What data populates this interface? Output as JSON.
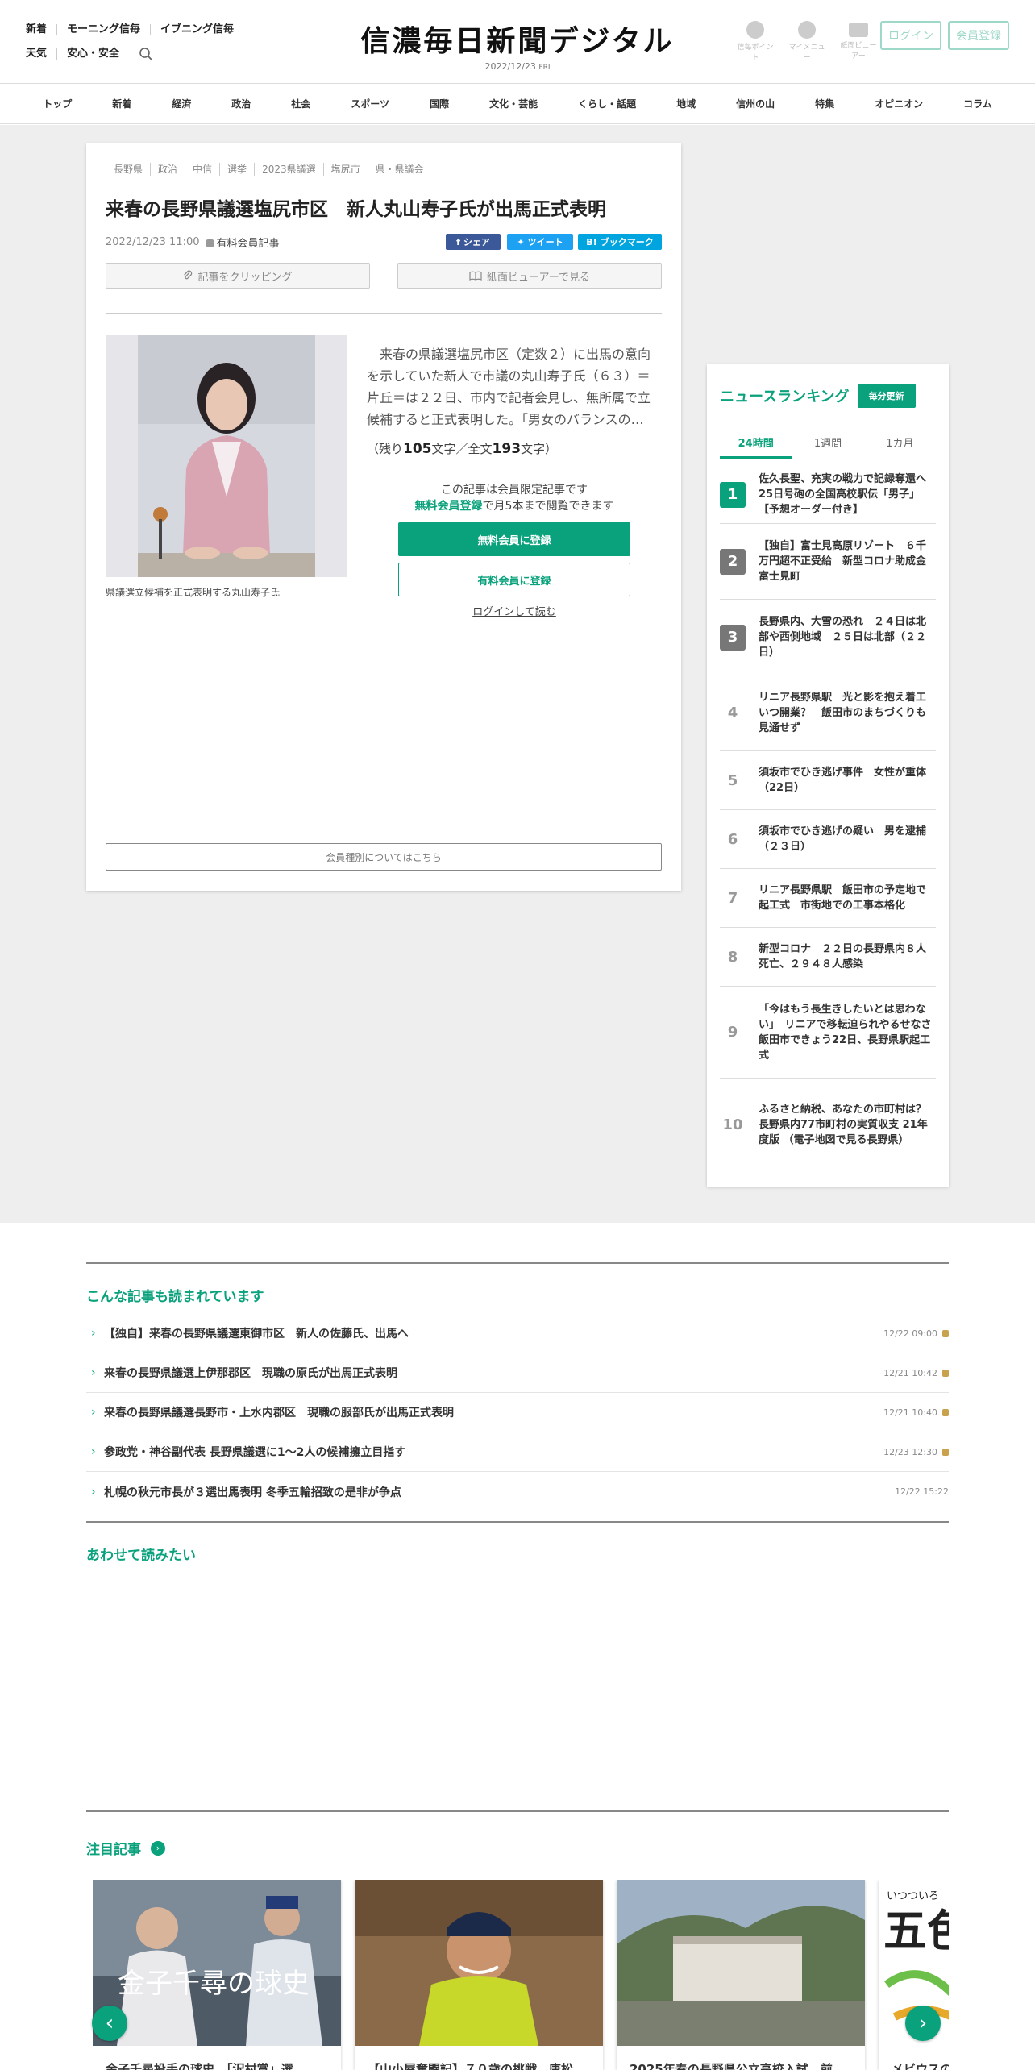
{
  "header": {
    "links_row1": [
      "新着",
      "モーニング信毎",
      "イブニング信毎"
    ],
    "links_row2": [
      "天気",
      "安心・安全"
    ],
    "logo": "信濃毎日新聞デジタル",
    "date": "2022/12/23",
    "weekday": "FRI",
    "icons": [
      {
        "label": "信毎ポイント",
        "icon": "point-icon"
      },
      {
        "label": "マイメニュー",
        "icon": "user-icon"
      },
      {
        "label": "紙面ビューアー",
        "icon": "book-icon"
      }
    ],
    "login": "ログイン",
    "register": "会員登録"
  },
  "nav": [
    "トップ",
    "新着",
    "経済",
    "政治",
    "社会",
    "スポーツ",
    "国際",
    "文化・芸能",
    "くらし・話題",
    "地域",
    "信州の山",
    "特集",
    "オピニオン",
    "コラム"
  ],
  "article": {
    "tags": [
      "長野県",
      "政治",
      "中信",
      "選挙",
      "2023県議選",
      "塩尻市",
      "県・県議会"
    ],
    "title": "来春の長野県議選塩尻市区　新人丸山寿子氏が出馬正式表明",
    "datetime": "2022/12/23 11:00",
    "paid_label": "有料会員記事",
    "share": {
      "facebook": "シェア",
      "twitter": "ツイート",
      "hatena": "ブックマーク"
    },
    "clip": "記事をクリッピング",
    "viewer": "紙面ビューアーで見る",
    "caption": "県議選立候補を正式表明する丸山寿子氏",
    "lede": "来春の県議選塩尻市区（定数２）に出馬の意向を示していた新人で市議の丸山寿子氏（６３）＝片丘＝は２２日、市内で記者会見し、無所属で立候補すると正式表明した。「男女のバランスの…",
    "remain_prefix": "（残り",
    "remain_chars": "105",
    "remain_mid": "文字／全文",
    "total_chars": "193",
    "remain_suffix": "文字）",
    "members_line1": "この記事は会員限定記事です",
    "members_hl": "無料会員登録",
    "members_line2": "で月5本まで閲覧できます",
    "free_register": "無料会員に登録",
    "paid_register": "有料会員に登録",
    "login_read": "ログインして読む",
    "member_types": "会員種別についてはこちら"
  },
  "ranking": {
    "title": "ニュースランキング",
    "badge": "毎分更新",
    "tabs": [
      "24時間",
      "1週間",
      "1カ月"
    ],
    "items": [
      {
        "rank": "1",
        "text": "佐久長聖、充実の戦力で記録奪還へ　25日号砲の全国高校駅伝「男子」　【予想オーダー付き】"
      },
      {
        "rank": "2",
        "text": "【独自】富士見高原リゾート　６千万円超不正受給　新型コロナ助成金　富士見町"
      },
      {
        "rank": "3",
        "text": "長野県内、大雪の恐れ　２４日は北部や西側地域　２５日は北部（２２日）"
      },
      {
        "rank": "4",
        "text": "リニア長野県駅　光と影を抱え着工　いつ開業？　飯田市のまちづくりも見通せず"
      },
      {
        "rank": "5",
        "text": "須坂市でひき逃げ事件　女性が重体（22日）"
      },
      {
        "rank": "6",
        "text": "須坂市でひき逃げの疑い　男を逮捕（２３日）"
      },
      {
        "rank": "7",
        "text": "リニア長野県駅　飯田市の予定地で起工式　市街地での工事本格化"
      },
      {
        "rank": "8",
        "text": "新型コロナ　２２日の長野県内８人死亡、２９４８人感染"
      },
      {
        "rank": "9",
        "text": "「今はもう長生きしたいとは思わない」　リニアで移転迫られやるせなさ　飯田市できょう22日、長野県駅起工式"
      },
      {
        "rank": "10",
        "text": "ふるさと納税、あなたの市町村は？　長野県内77市町村の実質収支 21年度版 （電子地図で見る長野県）"
      }
    ]
  },
  "popular": {
    "title": "こんな記事も読まれています",
    "items": [
      {
        "text": "【独自】来春の長野県議選東御市区　新人の佐藤氏、出馬へ",
        "time": "12/22 09:00",
        "locked": true
      },
      {
        "text": "来春の長野県議選上伊那郡区　現職の原氏が出馬正式表明",
        "time": "12/21 10:42",
        "locked": true
      },
      {
        "text": "来春の長野県議選長野市・上水内郡区　現職の服部氏が出馬正式表明",
        "time": "12/21 10:40",
        "locked": true
      },
      {
        "text": "参政党・神谷副代表 長野県議選に1～2人の候補擁立目指す",
        "time": "12/23 12:30",
        "locked": true
      },
      {
        "text": "札幌の秋元市長が３選出馬表明 冬季五輪招致の是非が争点",
        "time": "12/22 15:22",
        "locked": false
      }
    ]
  },
  "also_read": {
    "title": "あわせて読みたい"
  },
  "featured": {
    "title": "注目記事",
    "cards": [
      {
        "caption": "金子千尋投手の球史　「沢村賞」選",
        "overlay": "金子千尋の球史"
      },
      {
        "caption": "【山小屋奮闘記】７０歳の挑戦　唐松",
        "overlay": ""
      },
      {
        "caption": "2025年春の長野県公立高校入試　前",
        "overlay": ""
      },
      {
        "caption": "メビウスの",
        "overlay": "五色メビ",
        "overlay_top": "いつついろ"
      }
    ]
  },
  "colors": {
    "accent": "#0aa27c",
    "rank_gray": "#777777",
    "facebook": "#3b5998",
    "twitter": "#1da1f2",
    "hatena": "#00a4de"
  }
}
